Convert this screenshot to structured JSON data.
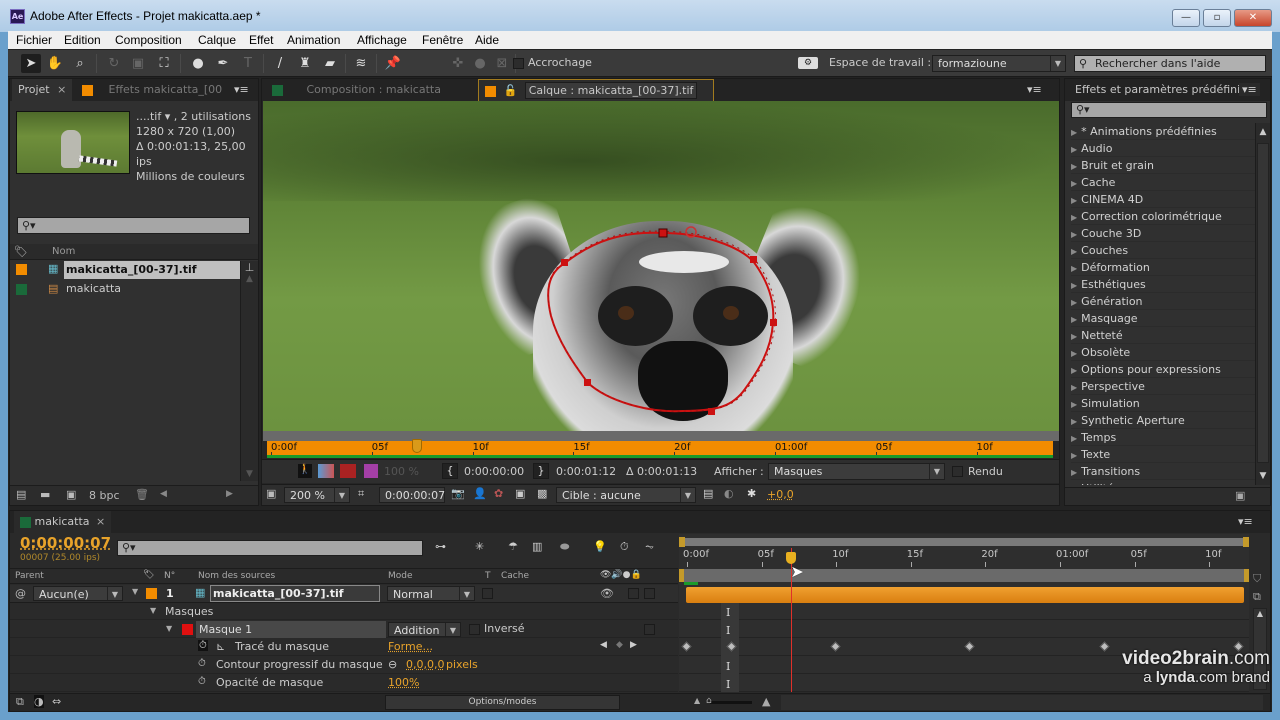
{
  "window": {
    "app_icon": "Ae",
    "title": "Adobe After Effects - Projet makicatta.aep *",
    "controls": {
      "minimize": "—",
      "maximize": "▫",
      "close": "✕"
    }
  },
  "menu": [
    "Fichier",
    "Edition",
    "Composition",
    "Calque",
    "Effet",
    "Animation",
    "Affichage",
    "Fenêtre",
    "Aide"
  ],
  "toolbar": {
    "tools": [
      "selection-tool",
      "hand-tool",
      "zoom-tool",
      "rotate-tool",
      "camera-tool",
      "pan-behind-tool",
      "ellipse-tool",
      "pen-tool",
      "text-tool",
      "brush-tool",
      "clone-stamp-tool",
      "eraser-tool",
      "roto-brush-tool",
      "puppet-tool"
    ],
    "snapping_label": "Accrochage",
    "snapping_checked": false,
    "workspace_label": "Espace de travail :",
    "workspace_value": "formazioune",
    "help_search_placeholder": "Rechercher dans l'aide"
  },
  "project_panel": {
    "tab_label": "Projet",
    "close": "×",
    "effects_tab_label": "Effets makicatta_[00",
    "info": {
      "name_line": "....tif ▾ , 2 utilisations",
      "dimensions": "1280 x 720 (1,00)",
      "duration": "Δ 0:00:01:13, 25,00 ips",
      "colors": "Millions de couleurs"
    },
    "search_placeholder": "",
    "column_name": "Nom",
    "items": [
      {
        "name": "makicatta_[00-37].tif",
        "label_color": "#f28c00",
        "type": "footage",
        "selected": true
      },
      {
        "name": "makicatta",
        "label_color": "#1a6a3a",
        "type": "composition",
        "selected": false
      }
    ],
    "bpc_label": "8 bpc"
  },
  "viewer": {
    "tabs": [
      {
        "label": "Composition : makicatta",
        "color": "#1a6a3a",
        "active": false
      },
      {
        "label": "Calque : makicatta_[00-37].tif",
        "color": "#f28c00",
        "active": true
      }
    ],
    "ruler_ticks": [
      "0:00f",
      "05f",
      "10f",
      "15f",
      "20f",
      "01:00f",
      "05f",
      "10f"
    ],
    "current_frame_fraction": 0.19,
    "in_label": "0:00:00:00",
    "out_label": "0:00:01:12",
    "duration_label": "Δ 0:00:01:13",
    "opacity_label": "100 %",
    "afficher_label": "Afficher :",
    "afficher_value": "Masques",
    "rendu_label": "Rendu",
    "zoom_value": "200 %",
    "current_time": "0:00:00:07",
    "target_value": "Cible : aucune",
    "exposure_value": "+0,0",
    "mask_color": "#cc1111"
  },
  "effects_panel": {
    "title": "Effets et paramètres prédéfinis",
    "search_placeholder": "",
    "items": [
      "* Animations prédéfinies",
      "Audio",
      "Bruit et grain",
      "Cache",
      "CINEMA 4D",
      "Correction colorimétrique",
      "Couche 3D",
      "Couches",
      "Déformation",
      "Esthétiques",
      "Génération",
      "Masquage",
      "Netteté",
      "Obsolète",
      "Options pour expressions",
      "Perspective",
      "Simulation",
      "Synthetic Aperture",
      "Temps",
      "Texte",
      "Transitions",
      "Utilité"
    ]
  },
  "timeline": {
    "tab_label": "makicatta",
    "close": "×",
    "timecode": "0:00:00:07",
    "frame_info": "00007 (25.00 ips)",
    "search_placeholder": "",
    "columns": {
      "parent": "Parent",
      "number": "N°",
      "source_name": "Nom des sources",
      "mode": "Mode",
      "t": "T",
      "cache": "Cache"
    },
    "layer": {
      "number": "1",
      "name": "makicatta_[00-37].tif",
      "parent": "Aucun(e)",
      "mode": "Normal",
      "label_color": "#f28c00"
    },
    "masks_group": "Masques",
    "mask": {
      "name": "Masque 1",
      "mode": "Addition",
      "inverted_label": "Inversé",
      "color": "#e01010"
    },
    "properties": [
      {
        "name": "Tracé du masque",
        "value": "Forme...",
        "unit": ""
      },
      {
        "name": "Contour progressif du masque",
        "value": "0,0,0,0",
        "unit": "pixels"
      },
      {
        "name": "Opacité de masque",
        "value": "100%",
        "unit": ""
      }
    ],
    "ruler_ticks": [
      "0:00f",
      "05f",
      "10f",
      "15f",
      "20f",
      "01:00f",
      "05f",
      "10f"
    ],
    "playhead_frame": 7,
    "total_frames": 38,
    "keyframe_frames": [
      0,
      3,
      10,
      19,
      28,
      37
    ],
    "options_label": "Options/modes"
  },
  "watermark": {
    "line1_bold": "video2brain",
    "line1_rest": ".com",
    "line2_a": "a ",
    "line2_bold": "lynda",
    "line2_rest": ".com brand"
  }
}
